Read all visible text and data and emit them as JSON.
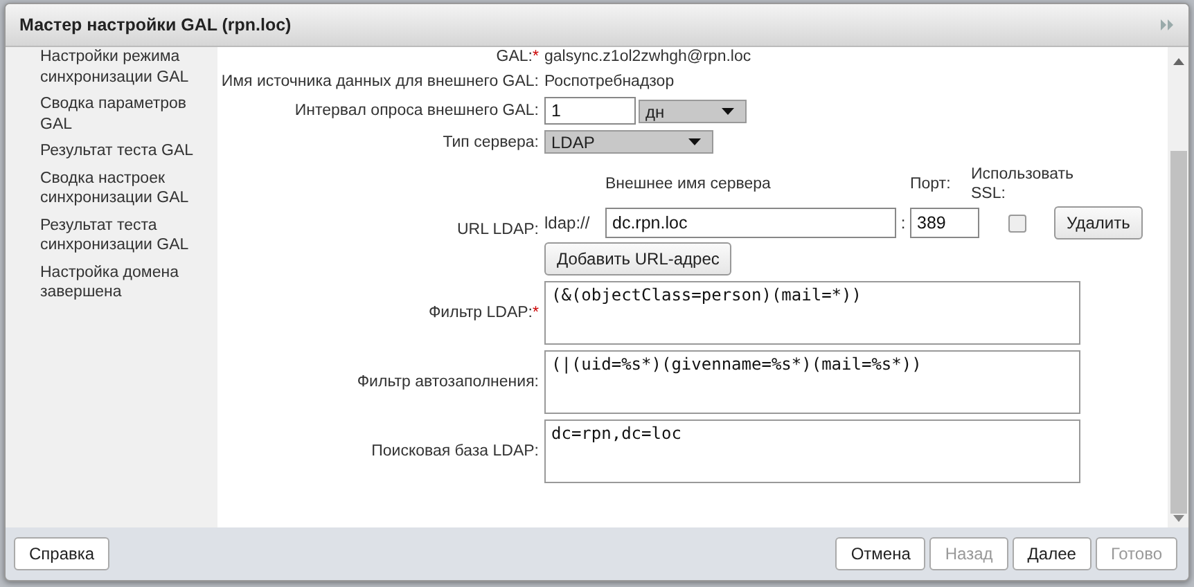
{
  "window": {
    "title": "Мастер настройки GAL (rpn.loc)"
  },
  "sidebar": {
    "items": [
      {
        "label": "Настройки режима синхронизации GAL"
      },
      {
        "label": "Сводка параметров GAL"
      },
      {
        "label": "Результат теста GAL"
      },
      {
        "label": "Сводка настроек синхронизации GAL"
      },
      {
        "label": "Результат теста синхронизации GAL"
      },
      {
        "label": "Настройка домена завершена"
      }
    ]
  },
  "form": {
    "rows": [
      {
        "kind": "text",
        "label": "GAL:",
        "required_mark": "*",
        "value": "galsync.z1ol2zwhgh@rpn.loc"
      },
      {
        "kind": "text",
        "label": "Имя источника данных для внешнего GAL:",
        "value": "Роспотребнадзор"
      },
      {
        "kind": "interval",
        "label": "Интервал опроса внешнего GAL:",
        "value": "1",
        "unit": "дн"
      },
      {
        "kind": "select",
        "label": "Тип сервера:",
        "value": "LDAP"
      },
      {
        "kind": "url",
        "label": "URL LDAP:",
        "host_header": "Внешнее имя сервера",
        "port_header": "Порт:",
        "ssl_header": "Использовать SSL:",
        "prefix": "ldap://",
        "host": "dc.rpn.loc",
        "separator": ":",
        "port": "389",
        "ssl_checked": false,
        "remove_button": "Удалить",
        "add_button": "Добавить URL-адрес"
      },
      {
        "kind": "textarea",
        "label": "Фильтр LDAP:",
        "required_mark": "*",
        "value": "(&(objectClass=person)(mail=*))"
      },
      {
        "kind": "textarea",
        "label": "Фильтр автозаполнения:",
        "value": "(|(uid=%s*)(givenname=%s*)(mail=%s*))"
      },
      {
        "kind": "textarea",
        "label": "Поисковая база LDAP:",
        "value": "dc=rpn,dc=loc"
      }
    ]
  },
  "footer": {
    "help_button": "Справка",
    "buttons": [
      {
        "label": "Отмена",
        "disabled": false
      },
      {
        "label": "Назад",
        "disabled": true
      },
      {
        "label": "Далее",
        "disabled": false
      },
      {
        "label": "Готово",
        "disabled": true
      }
    ]
  }
}
